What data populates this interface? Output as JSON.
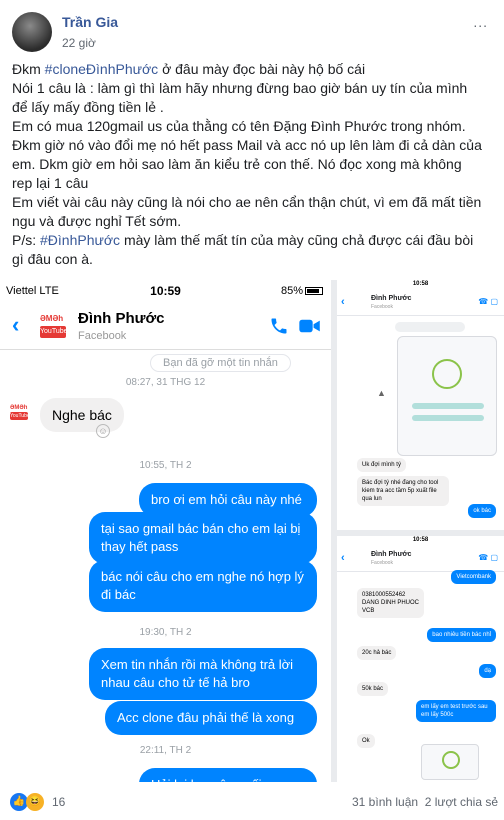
{
  "post": {
    "author": "Trần Gia",
    "time": "22 giờ",
    "more": "...",
    "lines": [
      {
        "a": "Đkm ",
        "tag": "#cloneĐìnhPhước",
        "b": " ở đâu mày đọc bài này hộ bố cái"
      },
      {
        "a": "Nói 1 câu là : làm gì thì làm hãy nhưng đừng bao giờ bán uy tín của mình",
        "tag": "",
        "b": ""
      },
      {
        "a": "để lấy mấy đồng tiền lẻ .",
        "tag": "",
        "b": ""
      },
      {
        "a": "Em có mua 120gmail us của thằng có tên Đặng Đình Phước trong nhóm.",
        "tag": "",
        "b": ""
      },
      {
        "a": "Đkm giờ nó vào đổi mẹ nó hết pass Mail và acc nó up lên làm đi cả dàn của",
        "tag": "",
        "b": ""
      },
      {
        "a": "em. Dkm giờ em hỏi sao làm ăn kiểu trẻ con thế. Nó đọc xong mà không",
        "tag": "",
        "b": ""
      },
      {
        "a": "rep lại 1 câu",
        "tag": "",
        "b": ""
      },
      {
        "a": "Em viết vài câu này cũng là nói cho ae nên cẩn thận chút, vì em đã mất tiền",
        "tag": "",
        "b": ""
      },
      {
        "a": "ngu và được nghỉ Tết sớm.",
        "tag": "",
        "b": ""
      },
      {
        "a": "P/s: ",
        "tag": "#ĐìnhPhước",
        "b": " mày làm thế mất tín của mày cũng chả được cái đầu bòi"
      },
      {
        "a": "gì đâu con à.",
        "tag": "",
        "b": ""
      }
    ]
  },
  "chat_main": {
    "carrier": "Viettel  LTE",
    "clock": "10:59",
    "battery": "85%",
    "contact": "Đình Phước",
    "contact_sub": "Facebook",
    "logo_top": "ƏMƏh",
    "logo_yt": "YouTube",
    "cut_msg": "Bạn đã gỡ một tin nhắn",
    "ts1": "08:27, 31 THG 12",
    "in1": "Nghe bác",
    "ts2": "10:55, TH 2",
    "out1": "bro ơi em hỏi câu này nhé",
    "out2": "tại sao gmail bác bán cho em lại bị thay hết pass",
    "out3": "bác nói câu cho em nghe nó hợp lý đi bác",
    "ts3": "19:30, TH 2",
    "out4": "Xem tin nhắn rồi mà không trả lời nhau câu cho tử tế hả bro",
    "out5": "Acc clone đâu phải thế là xong",
    "ts4": "22:11, TH 2",
    "out6": "Hỏi lại bro câu cuối"
  },
  "chat_small1": {
    "clock": "10:58",
    "contact": "Đình Phước",
    "sub": "Facebook",
    "in1": "Uk đợi mình tý",
    "in2": "Bác đợi tý nhé đang cho tool kiem tra acc tầm 5p xuất file qua lun",
    "out1": "ok bác"
  },
  "chat_small2": {
    "clock": "10:58",
    "contact": "Đình Phước",
    "sub": "Facebook",
    "out1": "Vietcombank",
    "in1": "0381000552462\nDANG DINH PHUOC\nVCB",
    "out2": "bao nhiêu tiền bác nhỉ",
    "in2": "20c hả bác",
    "out3": "dạ",
    "in3": "50k bác",
    "out4": "em lấy em test trước sau em lấy 500c",
    "in4": "Ok"
  },
  "footer": {
    "reaction_count": "16",
    "comments": "31 bình luận",
    "shares": "2 lượt chia sẻ"
  },
  "colors": {
    "messenger_blue": "#0084ff",
    "fb_link": "#385898"
  }
}
